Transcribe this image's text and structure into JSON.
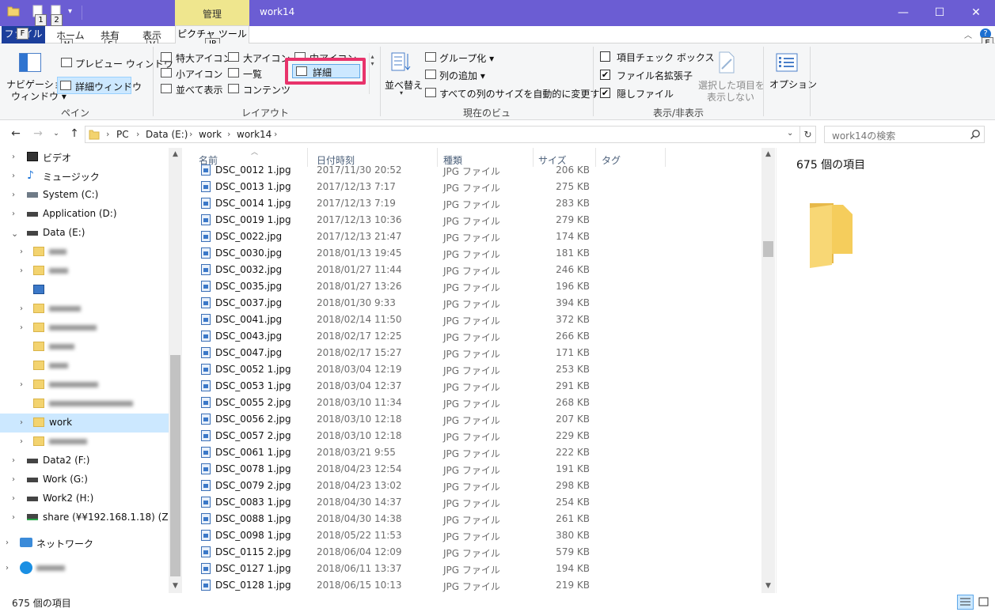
{
  "window": {
    "title": "work14",
    "context_tab": "管理",
    "qat_keytips": [
      "1",
      "2"
    ]
  },
  "ribbon_tabs": {
    "file": "ファイル",
    "file_keytip": "F",
    "home": "ホーム",
    "home_keytip": "H",
    "share": "共有",
    "share_keytip": "S",
    "view": "表示",
    "view_keytip": "V",
    "picture_tools": "ピクチャ ツール",
    "picture_keytip": "JP",
    "help_keytip": "E"
  },
  "ribbon": {
    "pane_group": {
      "nav_pane_line1": "ナビゲーション",
      "nav_pane_line2": "ウィンドウ ▾",
      "preview_pane": "プレビュー ウィンドウ",
      "details_pane": "詳細ウィンドウ",
      "label": "ペイン"
    },
    "layout_group": {
      "extra_large": "特大アイコン",
      "large": "大アイコン",
      "medium": "中アイコン",
      "small": "小アイコン",
      "list": "一覧",
      "details": "詳細",
      "tiles": "並べて表示",
      "content": "コンテンツ",
      "label": "レイアウト"
    },
    "current_view_group": {
      "sort_by": "並べ替え",
      "group_by": "グループ化 ▾",
      "add_columns": "列の追加 ▾",
      "size_all_columns": "すべての列のサイズを自動的に変更する",
      "label": "現在のビュー"
    },
    "show_hide_group": {
      "item_checkboxes": "項目チェック ボックス",
      "item_checkboxes_checked": false,
      "file_extensions": "ファイル名拡張子",
      "file_extensions_checked": true,
      "hidden_items": "隠しファイル",
      "hidden_items_checked": true,
      "hide_selected_line1": "選択した項目を",
      "hide_selected_line2": "表示しない",
      "label": "表示/非表示"
    },
    "options": "オプション",
    "highlight_color": "#e8336b"
  },
  "address": {
    "crumbs": [
      "PC",
      "Data (E:)",
      "work",
      "work14"
    ],
    "search_placeholder": "work14の検索"
  },
  "nav_pane": {
    "items": [
      {
        "label": "ビデオ",
        "icon": "video-icon"
      },
      {
        "label": "ミュージック",
        "icon": "music-icon"
      },
      {
        "label": "System (C:)",
        "icon": "drive-icon"
      },
      {
        "label": "Application (D:)",
        "icon": "drive-icon"
      },
      {
        "label": "Data (E:)",
        "icon": "drive-icon"
      },
      {
        "label": "work",
        "icon": "folder-icon"
      },
      {
        "label": "Data2 (F:)",
        "icon": "drive-icon"
      },
      {
        "label": "Work (G:)",
        "icon": "drive-icon"
      },
      {
        "label": "Work2 (H:)",
        "icon": "drive-icon"
      },
      {
        "label": "share (¥¥192.168.1.18) (Z:)",
        "icon": "network-drive-icon"
      },
      {
        "label": "ネットワーク",
        "icon": "network-icon"
      }
    ]
  },
  "file_list": {
    "columns": [
      "名前",
      "日付時刻",
      "種類",
      "サイズ",
      "タグ"
    ],
    "rows": [
      {
        "name": "DSC_0012 1.jpg",
        "date": "2017/11/30 20:52",
        "type": "JPG ファイル",
        "size": "206 KB"
      },
      {
        "name": "DSC_0013 1.jpg",
        "date": "2017/12/13 7:17",
        "type": "JPG ファイル",
        "size": "275 KB"
      },
      {
        "name": "DSC_0014 1.jpg",
        "date": "2017/12/13 7:19",
        "type": "JPG ファイル",
        "size": "283 KB"
      },
      {
        "name": "DSC_0019 1.jpg",
        "date": "2017/12/13 10:36",
        "type": "JPG ファイル",
        "size": "279 KB"
      },
      {
        "name": "DSC_0022.jpg",
        "date": "2017/12/13 21:47",
        "type": "JPG ファイル",
        "size": "174 KB"
      },
      {
        "name": "DSC_0030.jpg",
        "date": "2018/01/13 19:45",
        "type": "JPG ファイル",
        "size": "181 KB"
      },
      {
        "name": "DSC_0032.jpg",
        "date": "2018/01/27 11:44",
        "type": "JPG ファイル",
        "size": "246 KB"
      },
      {
        "name": "DSC_0035.jpg",
        "date": "2018/01/27 13:26",
        "type": "JPG ファイル",
        "size": "196 KB"
      },
      {
        "name": "DSC_0037.jpg",
        "date": "2018/01/30 9:33",
        "type": "JPG ファイル",
        "size": "394 KB"
      },
      {
        "name": "DSC_0041.jpg",
        "date": "2018/02/14 11:50",
        "type": "JPG ファイル",
        "size": "372 KB"
      },
      {
        "name": "DSC_0043.jpg",
        "date": "2018/02/17 12:25",
        "type": "JPG ファイル",
        "size": "266 KB"
      },
      {
        "name": "DSC_0047.jpg",
        "date": "2018/02/17 15:27",
        "type": "JPG ファイル",
        "size": "171 KB"
      },
      {
        "name": "DSC_0052 1.jpg",
        "date": "2018/03/04 12:19",
        "type": "JPG ファイル",
        "size": "253 KB"
      },
      {
        "name": "DSC_0053 1.jpg",
        "date": "2018/03/04 12:37",
        "type": "JPG ファイル",
        "size": "291 KB"
      },
      {
        "name": "DSC_0055 2.jpg",
        "date": "2018/03/10 11:34",
        "type": "JPG ファイル",
        "size": "268 KB"
      },
      {
        "name": "DSC_0056 2.jpg",
        "date": "2018/03/10 12:18",
        "type": "JPG ファイル",
        "size": "207 KB"
      },
      {
        "name": "DSC_0057 2.jpg",
        "date": "2018/03/10 12:18",
        "type": "JPG ファイル",
        "size": "229 KB"
      },
      {
        "name": "DSC_0061 1.jpg",
        "date": "2018/03/21 9:55",
        "type": "JPG ファイル",
        "size": "222 KB"
      },
      {
        "name": "DSC_0078 1.jpg",
        "date": "2018/04/23 12:54",
        "type": "JPG ファイル",
        "size": "191 KB"
      },
      {
        "name": "DSC_0079 2.jpg",
        "date": "2018/04/23 13:02",
        "type": "JPG ファイル",
        "size": "298 KB"
      },
      {
        "name": "DSC_0083 1.jpg",
        "date": "2018/04/30 14:37",
        "type": "JPG ファイル",
        "size": "254 KB"
      },
      {
        "name": "DSC_0088 1.jpg",
        "date": "2018/04/30 14:38",
        "type": "JPG ファイル",
        "size": "261 KB"
      },
      {
        "name": "DSC_0098 1.jpg",
        "date": "2018/05/22 11:53",
        "type": "JPG ファイル",
        "size": "380 KB"
      },
      {
        "name": "DSC_0115 2.jpg",
        "date": "2018/06/04 12:09",
        "type": "JPG ファイル",
        "size": "579 KB"
      },
      {
        "name": "DSC_0127 1.jpg",
        "date": "2018/06/11 13:37",
        "type": "JPG ファイル",
        "size": "194 KB"
      },
      {
        "name": "DSC_0128 1.jpg",
        "date": "2018/06/15 10:13",
        "type": "JPG ファイル",
        "size": "219 KB"
      }
    ]
  },
  "details_pane": {
    "item_count": "675 個の項目"
  },
  "status_bar": {
    "item_count": "675 個の項目"
  },
  "colors": {
    "titlebar": "#6b5dd3",
    "context_tab": "#efe68e",
    "file_tab": "#1c3f9c",
    "selection": "#cce8ff"
  }
}
